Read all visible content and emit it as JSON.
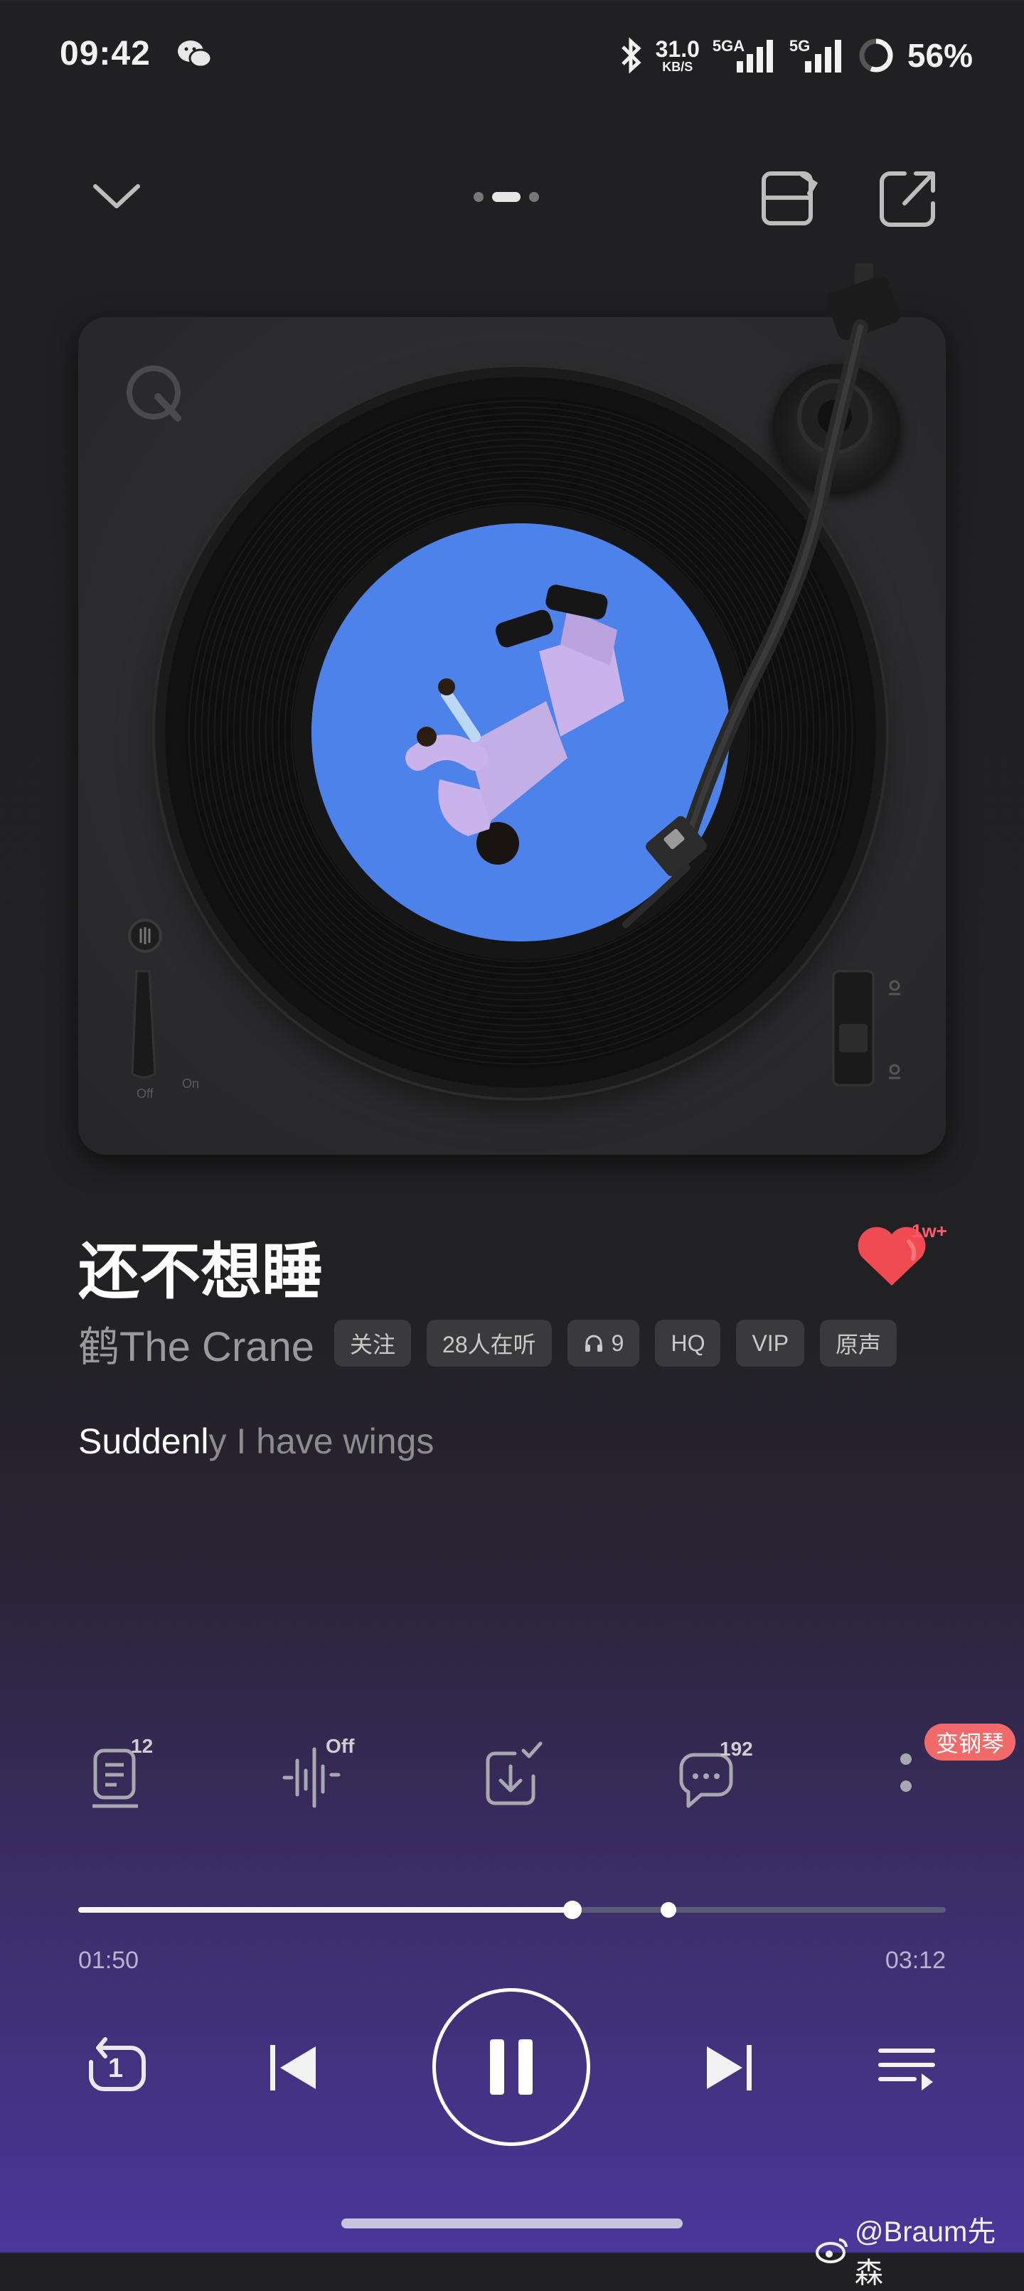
{
  "status_bar": {
    "time": "09:42",
    "net_speed_value": "31.0",
    "net_speed_unit": "KB/S",
    "signal1_label": "5GA",
    "signal2_label": "5G",
    "battery": "56%"
  },
  "top_nav": {
    "page_count": 3,
    "active_page": 2
  },
  "song": {
    "title": "还不想睡",
    "artist": "鹤The Crane",
    "like_count": "1w+",
    "tags": {
      "follow": "关注",
      "listeners": "28人在听",
      "headphone_count": "9",
      "quality": "HQ",
      "vip": "VIP",
      "original": "原声"
    }
  },
  "lyric": {
    "sung": "Suddenl",
    "rest": "y I have wings"
  },
  "actions": {
    "lyrics_count": "12",
    "effect_state": "Off",
    "comments_count": "192",
    "piano_tag": "变钢琴"
  },
  "progress": {
    "elapsed": "01:50",
    "total": "03:12",
    "played_fraction": 0.57,
    "buffered_fraction": 0.68
  },
  "controls": {
    "repeat_count": "1",
    "state": "playing"
  },
  "watermark": "@Braum先森",
  "colors": {
    "like": "#f04a52",
    "piano_tag": "#f06a6a",
    "cover_bg": "#4a7fe6"
  }
}
